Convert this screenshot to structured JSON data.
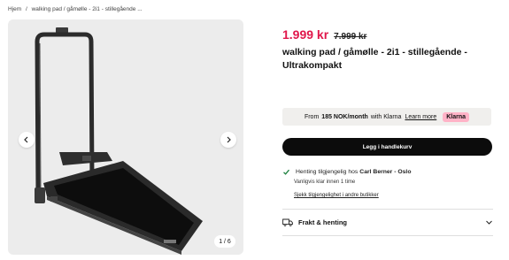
{
  "breadcrumb": {
    "items": [
      "Hjem",
      "/",
      "walking pad / gåmølle - 2i1 - stillegående ..."
    ]
  },
  "gallery": {
    "counter": "1 / 6",
    "prev_icon": "chevron-left-icon",
    "next_icon": "chevron-right-icon"
  },
  "product": {
    "price_sale": "1.999 kr",
    "price_old": "7.999 kr",
    "title": "walking pad / gåmølle - 2i1 - stillegående - Ultrakompakt"
  },
  "klarna": {
    "prefix": "From",
    "amount": "185 NOK/month",
    "suffix": "with Klarna",
    "learn_more": "Learn more",
    "badge": "Klarna"
  },
  "cart": {
    "button_label": "Legg i handlekurv"
  },
  "pickup": {
    "text": "Henting tilgjengelig hos",
    "store": "Carl Berner - Oslo",
    "ready": "Vanligvis klar innen 1 time",
    "link": "Sjekk tilgjengelighet i andre butikker"
  },
  "shipping": {
    "label": "Frakt & henting"
  },
  "colors": {
    "sale": "#e0174b",
    "button": "#0c0c0c",
    "klarna_badge": "#ffb3c7"
  }
}
